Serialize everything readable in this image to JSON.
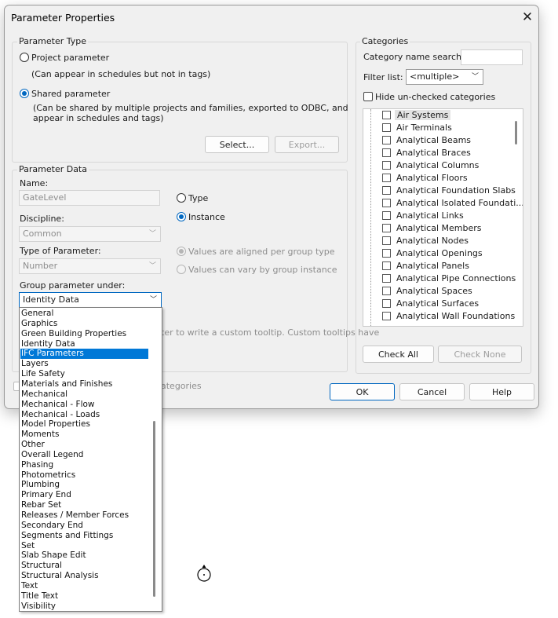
{
  "window": {
    "title": "Parameter Properties",
    "close_icon": "close-icon"
  },
  "parameter_type": {
    "heading": "Parameter Type",
    "project_label": "Project parameter",
    "project_desc": "(Can appear in schedules but not in tags)",
    "shared_label": "Shared parameter",
    "shared_desc_1": "(Can be shared by multiple projects and families, exported to ODBC, and",
    "shared_desc_2": "appear in schedules and tags)",
    "select_button": "Select...",
    "export_button": "Export..."
  },
  "parameter_data": {
    "heading": "Parameter Data",
    "name_label": "Name:",
    "name_value": "GateLevel",
    "discipline_label": "Discipline:",
    "discipline_value": "Common",
    "type_label": "Type of Parameter:",
    "type_value": "Number",
    "group_label": "Group parameter under:",
    "group_value": "Identity Data",
    "type_radio": "Type",
    "instance_radio": "Instance",
    "aligned_radio": "Values are aligned per group type",
    "vary_radio": "Values can vary by group instance",
    "tooltip_fragment": "ter to write a custom tooltip. Custom tooltips have",
    "categories_fragment": "ategories"
  },
  "group_dropdown": {
    "items": [
      "General",
      "Graphics",
      "Green Building Properties",
      "Identity Data",
      "IFC Parameters",
      "Layers",
      "Life Safety",
      "Materials and Finishes",
      "Mechanical",
      "Mechanical - Flow",
      "Mechanical - Loads",
      "Model Properties",
      "Moments",
      "Other",
      "Overall Legend",
      "Phasing",
      "Photometrics",
      "Plumbing",
      "Primary End",
      "Rebar Set",
      "Releases / Member Forces",
      "Secondary End",
      "Segments and Fittings",
      "Set",
      "Slab Shape Edit",
      "Structural",
      "Structural Analysis",
      "Text",
      "Title Text",
      "Visibility"
    ],
    "selected": "IFC Parameters"
  },
  "categories": {
    "heading": "Categories",
    "search_label": "Category name search:",
    "search_value": "",
    "filter_label": "Filter list:",
    "filter_value": "<multiple>",
    "hide_label": "Hide un-checked categories",
    "items": [
      "Air Systems",
      "Air Terminals",
      "Analytical Beams",
      "Analytical Braces",
      "Analytical Columns",
      "Analytical Floors",
      "Analytical Foundation Slabs",
      "Analytical Isolated Foundati...",
      "Analytical Links",
      "Analytical Members",
      "Analytical Nodes",
      "Analytical Openings",
      "Analytical Panels",
      "Analytical Pipe Connections",
      "Analytical Spaces",
      "Analytical Surfaces",
      "Analytical Wall Foundations"
    ],
    "check_all": "Check All",
    "check_none": "Check None"
  },
  "footer": {
    "ok": "OK",
    "cancel": "Cancel",
    "help": "Help"
  },
  "colors": {
    "accent": "#0067c0",
    "selection": "#0078d7"
  }
}
